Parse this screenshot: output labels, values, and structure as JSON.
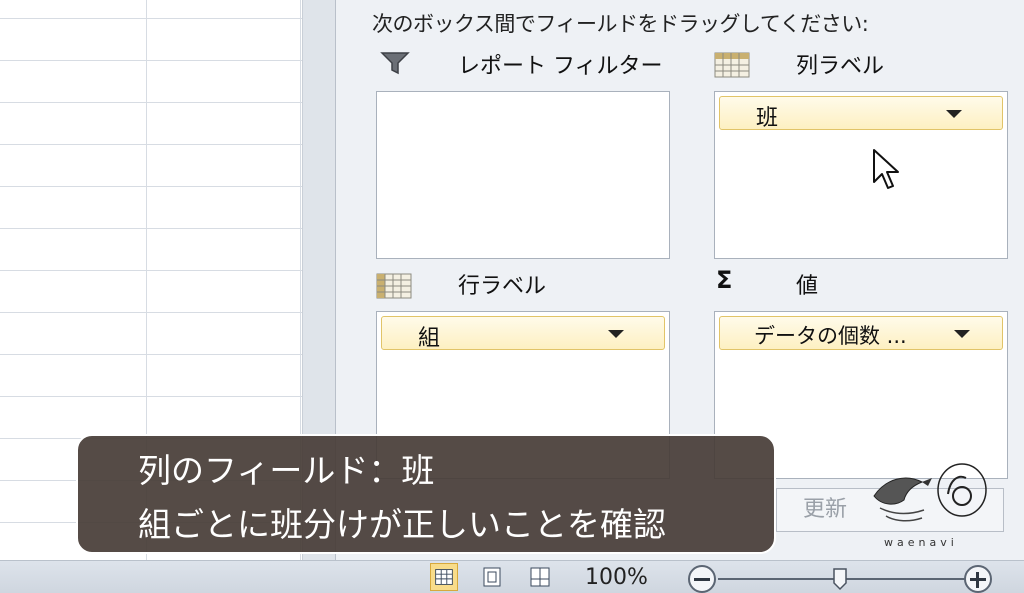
{
  "pivot_pane": {
    "instruction": "次のボックス間でフィールドをドラッグしてください:",
    "report_filter": {
      "label": "レポート フィルター"
    },
    "column_labels": {
      "label": "列ラベル",
      "field": "班"
    },
    "row_labels": {
      "label": "行ラベル",
      "field": "組"
    },
    "values": {
      "label": "値",
      "field": "データの個数 ...",
      "sigma": "Σ"
    },
    "update_button": "更新"
  },
  "caption": {
    "line1": "列のフィールド：班",
    "line2": "組ごとに班分けが正しいことを確認"
  },
  "status_bar": {
    "zoom": "100%"
  },
  "watermark": {
    "text": "waenavi"
  },
  "colors": {
    "field_border": "#e1c468",
    "field_fill": "#fdf0c2",
    "caption_bg": "#463c36"
  }
}
